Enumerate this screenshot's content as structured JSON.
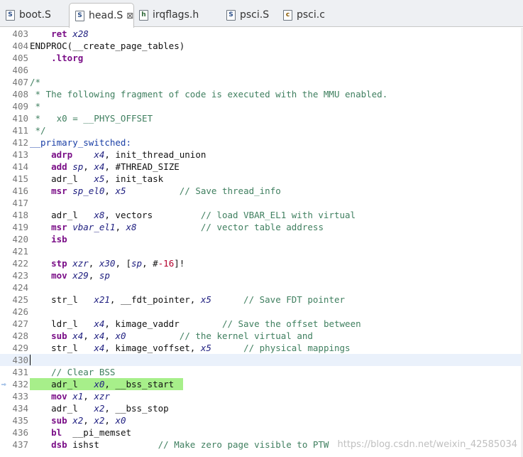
{
  "tabs": [
    {
      "icon": "asm-file-icon",
      "label": "boot.S",
      "active": false
    },
    {
      "icon": "asm-file-icon",
      "label": "head.S",
      "active": true,
      "close": "⊠"
    },
    {
      "icon": "header-file-icon",
      "label": "irqflags.h",
      "active": false
    },
    {
      "icon": "asm-file-icon",
      "label": "psci.S",
      "active": false
    },
    {
      "icon": "c-file-icon",
      "label": "psci.c",
      "active": false
    }
  ],
  "editor": {
    "current_line": 430,
    "highlighted_line": 432,
    "lines": [
      {
        "n": "403",
        "t": [
          [
            "    ",
            "txt"
          ],
          [
            "ret",
            "kw"
          ],
          [
            " ",
            "txt"
          ],
          [
            "x28",
            "reg"
          ]
        ]
      },
      {
        "n": "404",
        "t": [
          [
            "ENDPROC(__create_page_tables)",
            "txt"
          ]
        ]
      },
      {
        "n": "405",
        "t": [
          [
            "    ",
            "txt"
          ],
          [
            ".ltorg",
            "kw"
          ]
        ]
      },
      {
        "n": "406",
        "t": []
      },
      {
        "n": "407",
        "t": [
          [
            "/*",
            "cmt"
          ]
        ]
      },
      {
        "n": "408",
        "t": [
          [
            " * The following fragment of code is executed with the MMU enabled.",
            "cmt"
          ]
        ]
      },
      {
        "n": "409",
        "t": [
          [
            " *",
            "cmt"
          ]
        ]
      },
      {
        "n": "410",
        "t": [
          [
            " *   x0 = __PHYS_OFFSET",
            "cmt"
          ]
        ]
      },
      {
        "n": "411",
        "t": [
          [
            " */",
            "cmt"
          ]
        ]
      },
      {
        "n": "412",
        "t": [
          [
            "__primary_switched:",
            "lbl"
          ]
        ]
      },
      {
        "n": "413",
        "t": [
          [
            "    ",
            "txt"
          ],
          [
            "adrp",
            "kw"
          ],
          [
            "    ",
            "txt"
          ],
          [
            "x4",
            "reg"
          ],
          [
            ", init_thread_union",
            "txt"
          ]
        ]
      },
      {
        "n": "414",
        "t": [
          [
            "    ",
            "txt"
          ],
          [
            "add",
            "kw"
          ],
          [
            " ",
            "txt"
          ],
          [
            "sp",
            "reg"
          ],
          [
            ", ",
            "txt"
          ],
          [
            "x4",
            "reg"
          ],
          [
            ", #THREAD_SIZE",
            "txt"
          ]
        ]
      },
      {
        "n": "415",
        "t": [
          [
            "    adr_l   ",
            "txt"
          ],
          [
            "x5",
            "reg"
          ],
          [
            ", init_task",
            "txt"
          ]
        ]
      },
      {
        "n": "416",
        "t": [
          [
            "    ",
            "txt"
          ],
          [
            "msr",
            "kw"
          ],
          [
            " ",
            "txt"
          ],
          [
            "sp_el0",
            "reg"
          ],
          [
            ", ",
            "txt"
          ],
          [
            "x5",
            "reg"
          ],
          [
            "          ",
            "txt"
          ],
          [
            "// Save thread_info",
            "cmt"
          ]
        ]
      },
      {
        "n": "417",
        "t": []
      },
      {
        "n": "418",
        "t": [
          [
            "    adr_l   ",
            "txt"
          ],
          [
            "x8",
            "reg"
          ],
          [
            ", vectors         ",
            "txt"
          ],
          [
            "// load VBAR_EL1 with virtual",
            "cmt"
          ]
        ]
      },
      {
        "n": "419",
        "t": [
          [
            "    ",
            "txt"
          ],
          [
            "msr",
            "kw"
          ],
          [
            " ",
            "txt"
          ],
          [
            "vbar_el1",
            "reg"
          ],
          [
            ", ",
            "txt"
          ],
          [
            "x8",
            "reg"
          ],
          [
            "            ",
            "txt"
          ],
          [
            "// vector table address",
            "cmt"
          ]
        ]
      },
      {
        "n": "420",
        "t": [
          [
            "    ",
            "txt"
          ],
          [
            "isb",
            "kw"
          ]
        ]
      },
      {
        "n": "421",
        "t": []
      },
      {
        "n": "422",
        "t": [
          [
            "    ",
            "txt"
          ],
          [
            "stp",
            "kw"
          ],
          [
            " ",
            "txt"
          ],
          [
            "xzr",
            "reg"
          ],
          [
            ", ",
            "txt"
          ],
          [
            "x30",
            "reg"
          ],
          [
            ", [",
            "txt"
          ],
          [
            "sp",
            "reg"
          ],
          [
            ", #",
            "txt"
          ],
          [
            "-16",
            "num"
          ],
          [
            "]!",
            "txt"
          ]
        ]
      },
      {
        "n": "423",
        "t": [
          [
            "    ",
            "txt"
          ],
          [
            "mov",
            "kw"
          ],
          [
            " ",
            "txt"
          ],
          [
            "x29",
            "reg"
          ],
          [
            ", ",
            "txt"
          ],
          [
            "sp",
            "reg"
          ]
        ]
      },
      {
        "n": "424",
        "t": []
      },
      {
        "n": "425",
        "t": [
          [
            "    str_l   ",
            "txt"
          ],
          [
            "x21",
            "reg"
          ],
          [
            ", __fdt_pointer, ",
            "txt"
          ],
          [
            "x5",
            "reg"
          ],
          [
            "      ",
            "txt"
          ],
          [
            "// Save FDT pointer",
            "cmt"
          ]
        ]
      },
      {
        "n": "426",
        "t": []
      },
      {
        "n": "427",
        "t": [
          [
            "    ldr_l   ",
            "txt"
          ],
          [
            "x4",
            "reg"
          ],
          [
            ", kimage_vaddr        ",
            "txt"
          ],
          [
            "// Save the offset between",
            "cmt"
          ]
        ]
      },
      {
        "n": "428",
        "t": [
          [
            "    ",
            "txt"
          ],
          [
            "sub",
            "kw"
          ],
          [
            " ",
            "txt"
          ],
          [
            "x4",
            "reg"
          ],
          [
            ", ",
            "txt"
          ],
          [
            "x4",
            "reg"
          ],
          [
            ", ",
            "txt"
          ],
          [
            "x0",
            "reg"
          ],
          [
            "          ",
            "txt"
          ],
          [
            "// the kernel virtual and",
            "cmt"
          ]
        ]
      },
      {
        "n": "429",
        "t": [
          [
            "    str_l   ",
            "txt"
          ],
          [
            "x4",
            "reg"
          ],
          [
            ", kimage_voffset, ",
            "txt"
          ],
          [
            "x5",
            "reg"
          ],
          [
            "      ",
            "txt"
          ],
          [
            "// physical mappings",
            "cmt"
          ]
        ]
      },
      {
        "n": "430",
        "t": []
      },
      {
        "n": "431",
        "t": [
          [
            "    // Clear BSS",
            "cmt"
          ]
        ]
      },
      {
        "n": "432",
        "t": [
          [
            "    adr_l   ",
            "txt"
          ],
          [
            "x0",
            "reg"
          ],
          [
            ", __bss_start",
            "txt"
          ]
        ]
      },
      {
        "n": "433",
        "t": [
          [
            "    ",
            "txt"
          ],
          [
            "mov",
            "kw"
          ],
          [
            " ",
            "txt"
          ],
          [
            "x1",
            "reg"
          ],
          [
            ", ",
            "txt"
          ],
          [
            "xzr",
            "reg"
          ]
        ]
      },
      {
        "n": "434",
        "t": [
          [
            "    adr_l   ",
            "txt"
          ],
          [
            "x2",
            "reg"
          ],
          [
            ", __bss_stop",
            "txt"
          ]
        ]
      },
      {
        "n": "435",
        "t": [
          [
            "    ",
            "txt"
          ],
          [
            "sub",
            "kw"
          ],
          [
            " ",
            "txt"
          ],
          [
            "x2",
            "reg"
          ],
          [
            ", ",
            "txt"
          ],
          [
            "x2",
            "reg"
          ],
          [
            ", ",
            "txt"
          ],
          [
            "x0",
            "reg"
          ]
        ]
      },
      {
        "n": "436",
        "t": [
          [
            "    ",
            "txt"
          ],
          [
            "bl",
            "kw"
          ],
          [
            "  __pi_memset",
            "txt"
          ]
        ]
      },
      {
        "n": "437",
        "t": [
          [
            "    ",
            "txt"
          ],
          [
            "dsb",
            "kw"
          ],
          [
            " ishst",
            "txt"
          ],
          [
            "           ",
            "txt"
          ],
          [
            "// Make zero page visible to PTW",
            "cmt"
          ]
        ]
      }
    ]
  },
  "watermark": "https://blog.csdn.net/weixin_42585034"
}
